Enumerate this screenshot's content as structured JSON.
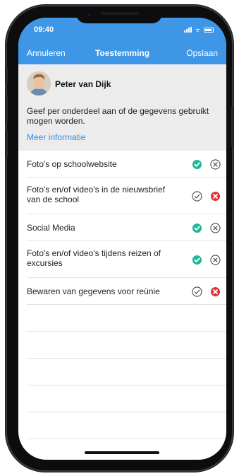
{
  "status_bar": {
    "time": "09:40"
  },
  "nav": {
    "cancel_label": "Annuleren",
    "title": "Toestemming",
    "save_label": "Opslaan"
  },
  "person": {
    "name": "Peter van Dijk",
    "intro": "Geef per onderdeel aan of de gegevens gebruikt mogen worden.",
    "more_info_label": "Meer informatie"
  },
  "consent_items": [
    {
      "label": "Foto's op schoolwebsite",
      "granted": true
    },
    {
      "label": "Foto's en/of video's in de nieuwsbrief van de school",
      "granted": false
    },
    {
      "label": "Social Media",
      "granted": true
    },
    {
      "label": "Foto's en/of video's tijdens reizen of excursies",
      "granted": true
    },
    {
      "label": "Bewaren van gegevens voor reünie",
      "granted": false
    }
  ],
  "colors": {
    "accent": "#3d97e6",
    "granted": "#1fb89a",
    "denied": "#e0343c",
    "link": "#2f8fe0"
  },
  "icons": {
    "yes_selected": "check-circle-filled-icon",
    "yes_unselected": "check-circle-outline-icon",
    "no_selected": "x-circle-filled-icon",
    "no_unselected": "x-circle-outline-icon"
  }
}
